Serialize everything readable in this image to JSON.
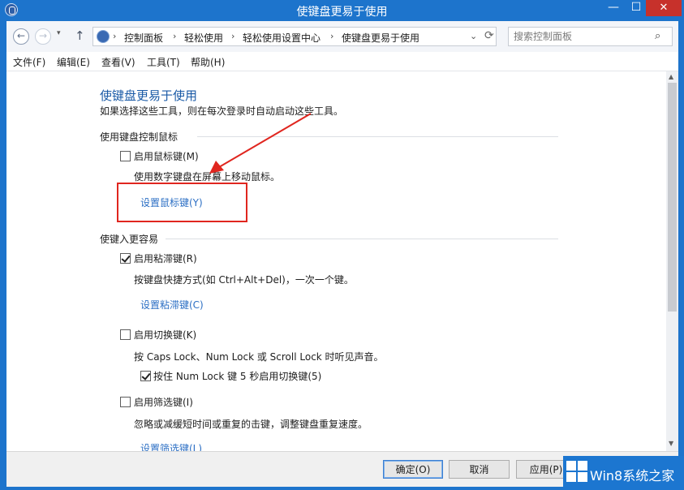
{
  "window": {
    "title": "使键盘更易于使用",
    "minimize": "—",
    "maximize": "☐",
    "close": "✕"
  },
  "nav": {
    "back": "←",
    "forward": "→",
    "recent": "▾",
    "up": "↑",
    "breadcrumbs": [
      "控制面板",
      "轻松使用",
      "轻松使用设置中心",
      "使键盘更易于使用"
    ],
    "separator": "›",
    "dropdown": "⌄",
    "refresh": "⟳",
    "search_placeholder": "搜索控制面板",
    "search_icon": "⌕"
  },
  "menu": [
    "文件(F)",
    "编辑(E)",
    "查看(V)",
    "工具(T)",
    "帮助(H)"
  ],
  "content": {
    "title": "使键盘更易于使用",
    "description": "如果选择这些工具，则在每次登录时自动启动这些工具。",
    "section_mouse": {
      "heading": "使用键盘控制鼠标",
      "mouse_keys": {
        "label": "启用鼠标键(M)",
        "checked": false
      },
      "mouse_keys_desc": "使用数字键盘在屏幕上移动鼠标。",
      "mouse_keys_link": "设置鼠标键(Y)"
    },
    "section_typing": {
      "heading": "使键入更容易",
      "sticky_keys": {
        "label": "启用粘滞键(R)",
        "checked": true
      },
      "sticky_keys_desc": "按键盘快捷方式(如 Ctrl+Alt+Del)，一次一个键。",
      "sticky_keys_link": "设置粘滞键(C)",
      "toggle_keys": {
        "label": "启用切换键(K)",
        "checked": false
      },
      "toggle_keys_desc": "按 Caps Lock、Num Lock 或 Scroll Lock 时听见声音。",
      "toggle_numlock": {
        "label": "按住 Num Lock 键 5 秒启用切换键(5)",
        "checked": true
      },
      "filter_keys": {
        "label": "启用筛选键(I)",
        "checked": false
      },
      "filter_keys_desc": "忽略或减缓短时间或重复的击键，调整键盘重复速度。",
      "filter_keys_link": "设置筛选键(L)"
    }
  },
  "footer": {
    "ok": "确定(O)",
    "cancel": "取消",
    "apply": "应用(P)"
  },
  "watermark": "Win8系统之家",
  "colors": {
    "accent": "#1d74cc",
    "link": "#2c6fc4",
    "title": "#1a5aa6",
    "annotation": "#e0261f"
  }
}
